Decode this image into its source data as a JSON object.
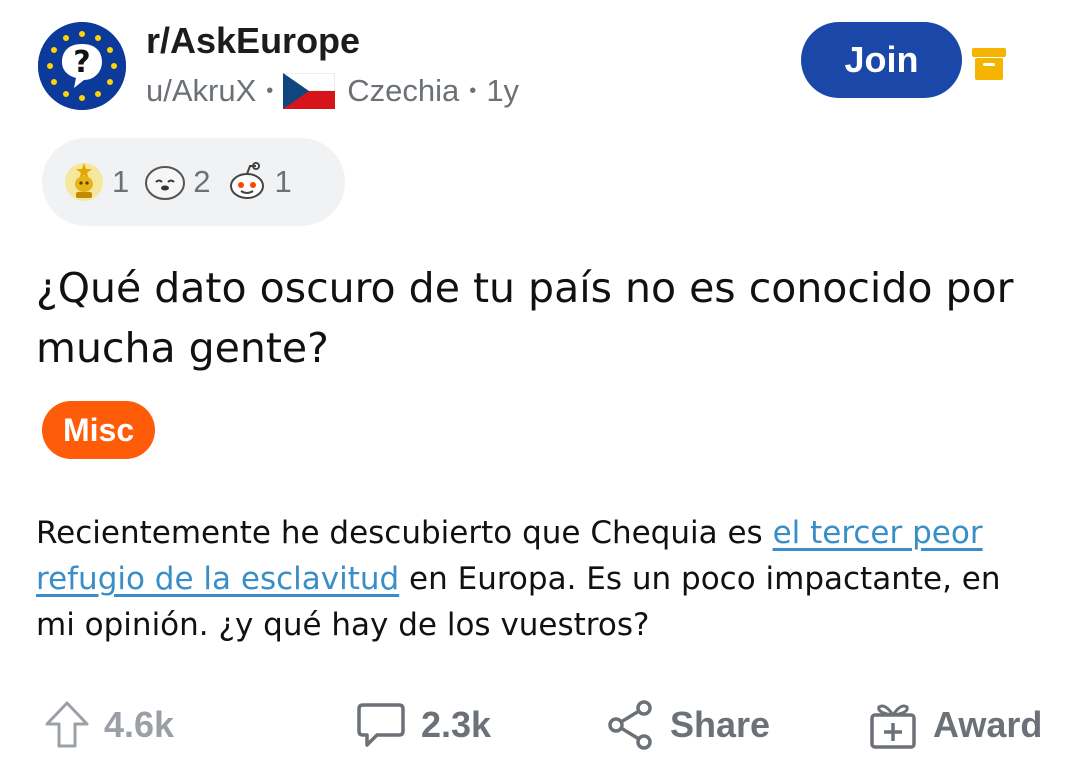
{
  "header": {
    "subreddit": "r/AskEurope",
    "author": "u/AkruX",
    "country": "Czechia",
    "age": "1y",
    "join_label": "Join",
    "subreddit_icon": "question-mark-eu-stars-icon",
    "flag_icon": "czech-flag-icon",
    "archive_icon": "archive-icon"
  },
  "awards": [
    {
      "icon": "gold-trophy-award-icon",
      "count": "1"
    },
    {
      "icon": "wholesome-seal-award-icon",
      "count": "2"
    },
    {
      "icon": "snoo-award-icon",
      "count": "1"
    }
  ],
  "post": {
    "title": "¿Qué dato oscuro de tu país no es conocido por mucha gente?",
    "flair": "Misc",
    "body_before": "Recientemente he descubierto que Chequia es ",
    "body_link": "el tercer peor refugio de la esclavitud",
    "body_after": " en Europa. Es un poco impactante, en mi opinión. ¿y qué hay de los vuestros?"
  },
  "actions": {
    "upvotes": "4.6k",
    "comments": "2.3k",
    "share_label": "Share",
    "award_label": "Award"
  },
  "colors": {
    "join_button": "#1b48a8",
    "flair": "#ff5c0a",
    "link": "#3a8ec8",
    "archive": "#f5b400",
    "muted_text": "#6b7177"
  }
}
